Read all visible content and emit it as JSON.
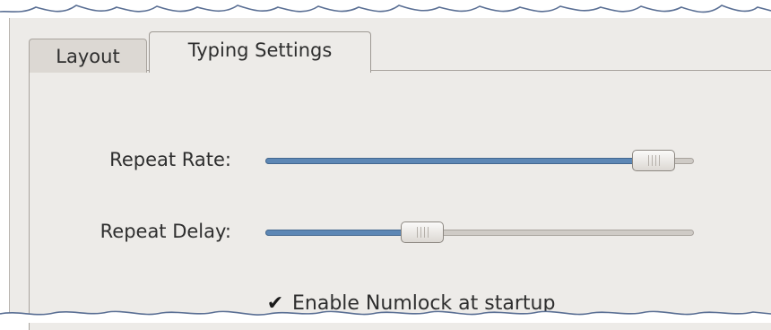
{
  "tabs": [
    {
      "label": "Layout",
      "selected": false
    },
    {
      "label": "Typing Settings",
      "selected": true
    }
  ],
  "repeat_rate": {
    "label": "Repeat Rate:",
    "value_fraction": 0.95
  },
  "repeat_delay": {
    "label": "Repeat Delay:",
    "value_fraction": 0.35
  },
  "numlock": {
    "label": "Enable Numlock at startup",
    "checked": true
  },
  "colors": {
    "slider_fill": "#5d87b5",
    "background": "#edebe8"
  },
  "icons": {
    "check": "checkmark-icon",
    "handle": "slider-handle-icon"
  }
}
